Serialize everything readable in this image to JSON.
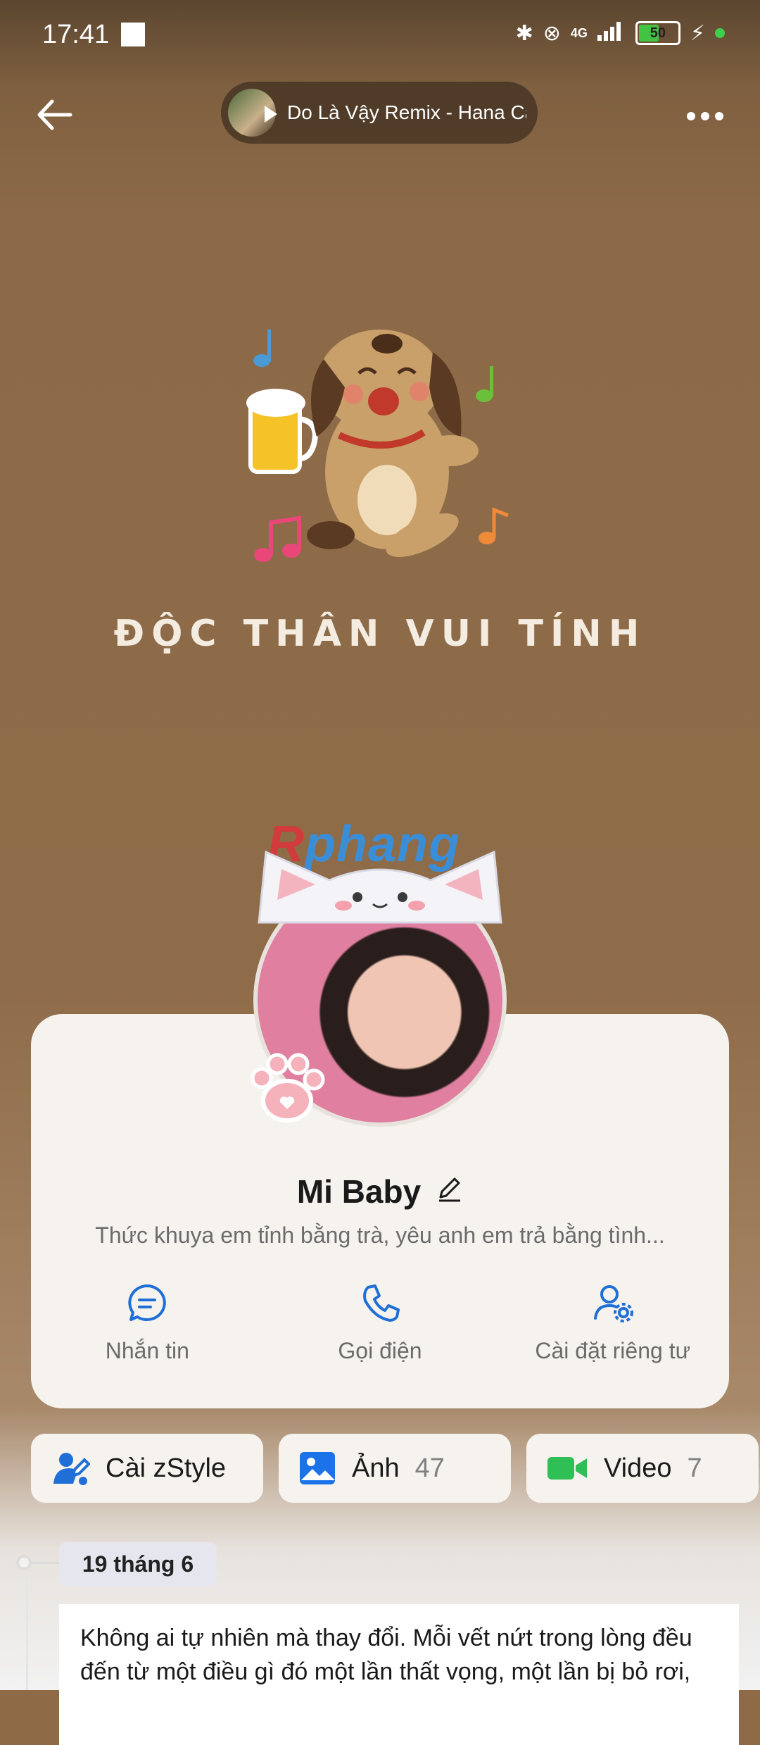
{
  "status_bar": {
    "time": "17:41",
    "network": "4G",
    "battery": "50"
  },
  "nav": {
    "back_icon": "arrow-left-icon",
    "more_icon": "more-horizontal-icon",
    "music_title": "Do Là Vậy Remix - Hana Cẩm"
  },
  "cover": {
    "caption": "ĐỘC THÂN VUI TÍNH"
  },
  "watermark": {
    "prefix": "R",
    "suffix": "phang"
  },
  "profile": {
    "name": "Mi Baby",
    "bio": "Thức khuya em tỉnh bằng trà, yêu anh em trả bằng tình...",
    "actions": [
      {
        "label": "Nhắn tin",
        "icon": "chat-bubble-icon"
      },
      {
        "label": "Gọi điện",
        "icon": "phone-icon"
      },
      {
        "label": "Cài đặt riêng tư",
        "icon": "user-settings-icon"
      }
    ]
  },
  "chips": [
    {
      "label": "Cài zStyle",
      "count": "",
      "icon": "zstyle-icon"
    },
    {
      "label": "Ảnh",
      "count": "47",
      "icon": "image-icon"
    },
    {
      "label": "Video",
      "count": "7",
      "icon": "video-camera-icon"
    }
  ],
  "timeline": {
    "date": "19 tháng 6",
    "post_text": "Không ai tự nhiên mà thay đổi. Mỗi vết nứt trong lòng đều đến từ một điều gì đó một lần thất vọng, một lần bị bỏ rơi,"
  },
  "colors": {
    "accent": "#1f6fd6",
    "chip_image": "#1a73e8",
    "chip_video": "#2fbf55"
  }
}
